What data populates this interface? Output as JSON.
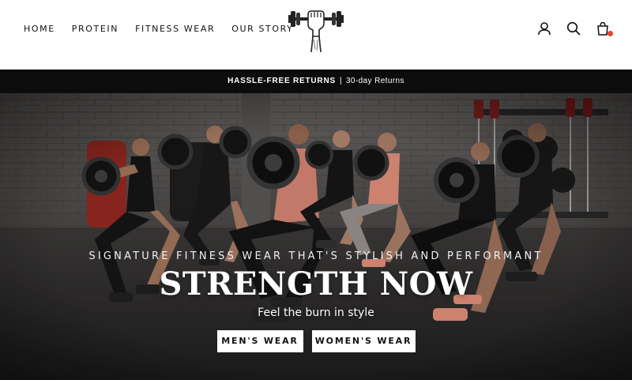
{
  "nav": {
    "items": [
      {
        "label": "HOME"
      },
      {
        "label": "PROTEIN"
      },
      {
        "label": "FITNESS WEAR"
      },
      {
        "label": "OUR STORY"
      }
    ]
  },
  "header_icons": [
    "user-icon",
    "search-icon",
    "cart-icon"
  ],
  "announcement": {
    "bold": "HASSLE-FREE RETURNS",
    "separator": "|",
    "text": "30-day Returns"
  },
  "hero": {
    "kicker": "SIGNATURE FITNESS WEAR THAT'S STYLISH AND PERFORMANT",
    "headline": "STRENGTH NOW",
    "subline": "Feel the burn in style",
    "buttons": [
      {
        "label": "MEN'S WEAR"
      },
      {
        "label": "WOMEN'S WEAR"
      }
    ]
  },
  "colors": {
    "announcement_bg": "#0c0c0c",
    "cart_badge": "#e8412c",
    "accent_pink": "#e9957f"
  }
}
